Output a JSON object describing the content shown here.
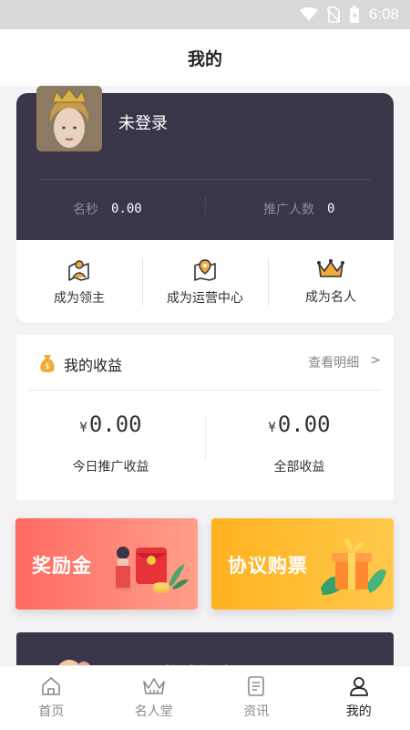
{
  "status_bar": {
    "time": "6:08"
  },
  "header": {
    "title": "我的"
  },
  "profile": {
    "username": "未登录",
    "stats": [
      {
        "label": "名秒",
        "value": "0.00"
      },
      {
        "label": "推广人数",
        "value": "0"
      }
    ],
    "actions": [
      {
        "label": "成为领主",
        "icon": "lord-user-icon"
      },
      {
        "label": "成为运营中心",
        "icon": "map-pin-icon"
      },
      {
        "label": "成为名人",
        "icon": "crown-icon"
      }
    ]
  },
  "income": {
    "title": "我的收益",
    "detail_link": "查看明细",
    "chevron": ">",
    "items": [
      {
        "currency": "¥",
        "amount": "0.00",
        "label": "今日推广收益"
      },
      {
        "currency": "¥",
        "amount": "0.00",
        "label": "全部收益"
      }
    ]
  },
  "banners": [
    {
      "label": "奖励金",
      "color": "#ff6a62"
    },
    {
      "label": "协议购票",
      "color": "#ffb21f"
    }
  ],
  "invite": {
    "label": "邀请好友"
  },
  "tabbar": {
    "items": [
      {
        "label": "首页",
        "icon": "home-icon"
      },
      {
        "label": "名人堂",
        "icon": "crown-icon"
      },
      {
        "label": "资讯",
        "icon": "news-icon"
      },
      {
        "label": "我的",
        "icon": "user-icon"
      }
    ],
    "active_index": 3
  },
  "colors": {
    "card_dark": "#3a3549",
    "accent_red": "#ff6a62",
    "accent_orange": "#ffb21f"
  }
}
